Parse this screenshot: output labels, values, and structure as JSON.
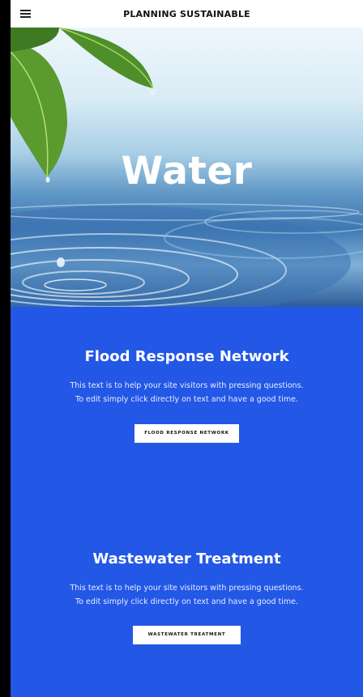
{
  "header": {
    "brand": "PLANNING SUSTAINABLE",
    "menu_icon": "hamburger-menu-icon"
  },
  "hero": {
    "title": "Water"
  },
  "sections": [
    {
      "title": "Flood Response Network",
      "text_line1": "This text is to help your site visitors with pressing questions.",
      "text_line2": "To edit simply click directly on text and have a good time.",
      "button": "FLOOD RESPONSE NETWORK"
    },
    {
      "title": "Wastewater Treatment",
      "text_line1": "This text is to help your site visitors with pressing questions.",
      "text_line2": "To edit simply click directly on text and have a good time.",
      "button": "WASTEWATER TREATMENT"
    }
  ],
  "colors": {
    "accent": "#2357e6",
    "header_bg": "#ffffff",
    "text_light": "#ffffff"
  }
}
